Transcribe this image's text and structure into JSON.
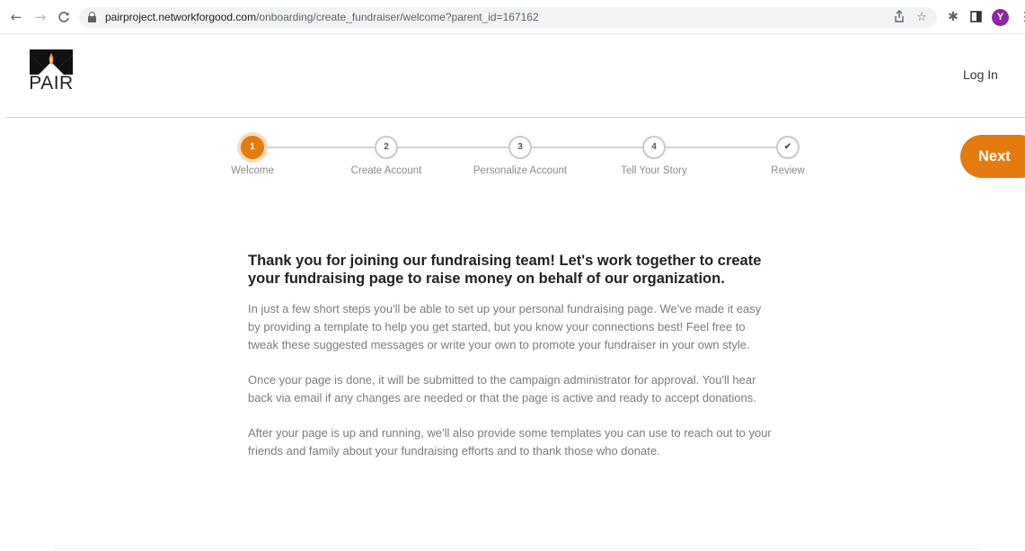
{
  "browser": {
    "back_icon": "←",
    "forward_icon": "→",
    "reload_icon": "C",
    "url_host": "pairproject.networkforgood.com",
    "url_path": "/onboarding/create_fundraiser/welcome?parent_id=167162",
    "share_icon": "⇪",
    "bookmark_icon": "☆",
    "extensions_icon": "✱",
    "sidepanel_icon": "◧",
    "profile_initial": "Y",
    "menu_icon": "⋮"
  },
  "header": {
    "logo_text": "PAIR",
    "login_label": "Log In"
  },
  "stepper": {
    "steps": [
      {
        "number": "1",
        "label": "Welcome"
      },
      {
        "number": "2",
        "label": "Create Account"
      },
      {
        "number": "3",
        "label": "Personalize Account"
      },
      {
        "number": "4",
        "label": "Tell Your Story"
      },
      {
        "number": "✔",
        "label": "Review"
      }
    ],
    "active_step": 1,
    "next_label": "Next"
  },
  "content": {
    "heading_line1": "Thank you for joining our fundraising team! Let's work together to create",
    "heading_line2": "your fundraising page to raise money on behalf of our organization.",
    "paragraph1_line1": "In just a few short steps you'll be able to set up your personal fundraising page. We've made it easy",
    "paragraph1_line2": "by providing a template to help you get started, but you know your connections best! Feel free to",
    "paragraph1_line3": "tweak these suggested messages or write your own to promote your fundraiser in your own style.",
    "paragraph2_line1": "Once your page is done, it will be submitted to the campaign administrator for approval. You'll hear",
    "paragraph2_line2": "back via email if any changes are needed or that the page is active and ready to accept donations.",
    "paragraph3_line1": "After your page is up and running, we'll also provide some templates you can use to reach out to your",
    "paragraph3_line2": "friends and family about your fundraising efforts and to thank those who donate."
  },
  "colors": {
    "accent": "#e57b0e",
    "profile": "#8e24aa"
  }
}
